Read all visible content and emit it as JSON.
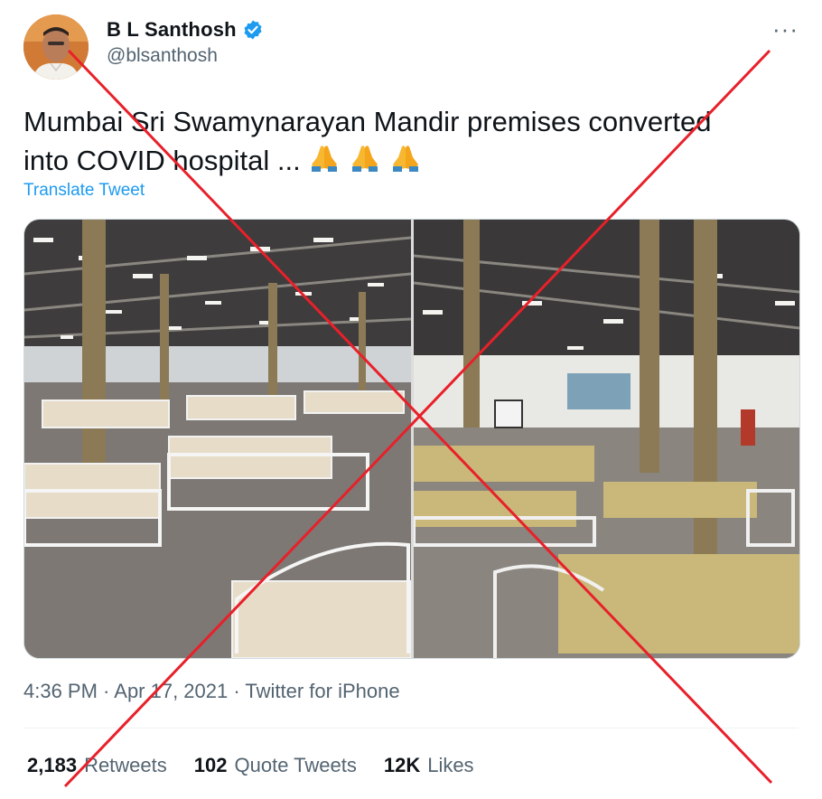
{
  "author": {
    "display_name": "B L Santhosh",
    "handle": "@blsanthosh",
    "verified_icon": "verified-badge-icon"
  },
  "menu": {
    "more_label": "···"
  },
  "tweet": {
    "text": "Mumbai Sri Swamynarayan Mandir premises converted into COVID hospital ... ",
    "emojis": [
      "folded-hands-emoji",
      "folded-hands-emoji",
      "folded-hands-emoji"
    ],
    "translate_label": "Translate Tweet"
  },
  "meta": {
    "timestamp": "4:36 PM · Apr 17, 2021 · Twitter for iPhone"
  },
  "stats": [
    {
      "count": "2,183",
      "label": "Retweets"
    },
    {
      "count": "102",
      "label": "Quote Tweets"
    },
    {
      "count": "12K",
      "label": "Likes"
    }
  ],
  "colors": {
    "link": "#1d9bf0",
    "secondary_text": "#536471",
    "cross_mark": "#e8202a"
  }
}
